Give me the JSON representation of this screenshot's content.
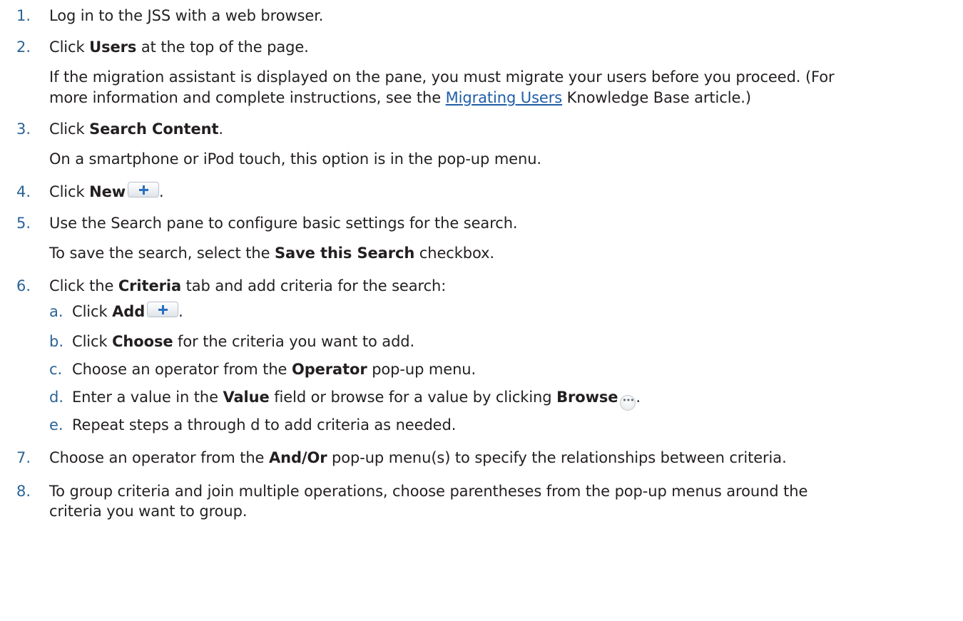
{
  "steps": [
    {
      "num": "1.",
      "text": "Log in to the JSS with a web browser."
    },
    {
      "num": "2.",
      "pre": "Click ",
      "bold": "Users",
      "post": " at the top of the page.",
      "note1_line1": "If the migration assistant is displayed on the pane, you must migrate your users before you proceed. (For",
      "note1_line2_pre": "more information and complete instructions, see the ",
      "note1_link": "Migrating Users",
      "note1_line2_post": " Knowledge Base article.)"
    },
    {
      "num": "3.",
      "pre": "Click ",
      "bold": "Search Content",
      "post": ".",
      "note": "On a smartphone or iPod touch, this option is in the pop-up menu."
    },
    {
      "num": "4.",
      "pre": "Click ",
      "bold": "New",
      "icon": "plus-icon",
      "post": "."
    },
    {
      "num": "5.",
      "text": "Use the Search pane to configure basic settings for the search.",
      "note_pre": "To save the search, select the ",
      "note_bold": "Save this Search",
      "note_post": " checkbox."
    },
    {
      "num": "6.",
      "pre": "Click the ",
      "bold": "Criteria",
      "post": " tab and add criteria for the search:",
      "substeps": [
        {
          "letter": "a.",
          "pre": "Click ",
          "bold": "Add",
          "icon": "plus-icon",
          "post": "."
        },
        {
          "letter": "b.",
          "pre": "Click ",
          "bold": "Choose",
          "post": " for the criteria you want to add."
        },
        {
          "letter": "c.",
          "pre": "Choose an operator from the ",
          "bold": "Operator",
          "post": " pop-up menu."
        },
        {
          "letter": "d.",
          "pre": "Enter a value in the ",
          "bold": "Value",
          "mid": " field or browse for a value by clicking ",
          "bold2": "Browse",
          "icon": "ellipsis-icon",
          "post": "."
        },
        {
          "letter": "e.",
          "text": "Repeat steps a through d to add criteria as needed."
        }
      ]
    },
    {
      "num": "7.",
      "pre": "Choose an operator from the ",
      "bold": "And/Or",
      "post": " pop-up menu(s) to specify the relationships between criteria."
    },
    {
      "num": "8.",
      "line1": "To group criteria and join multiple operations, choose parentheses from the pop-up menus around the",
      "line2": "criteria you want to group."
    }
  ],
  "colors": {
    "number": "#2a6496",
    "link": "#1f5ea8",
    "text": "#231f20"
  }
}
